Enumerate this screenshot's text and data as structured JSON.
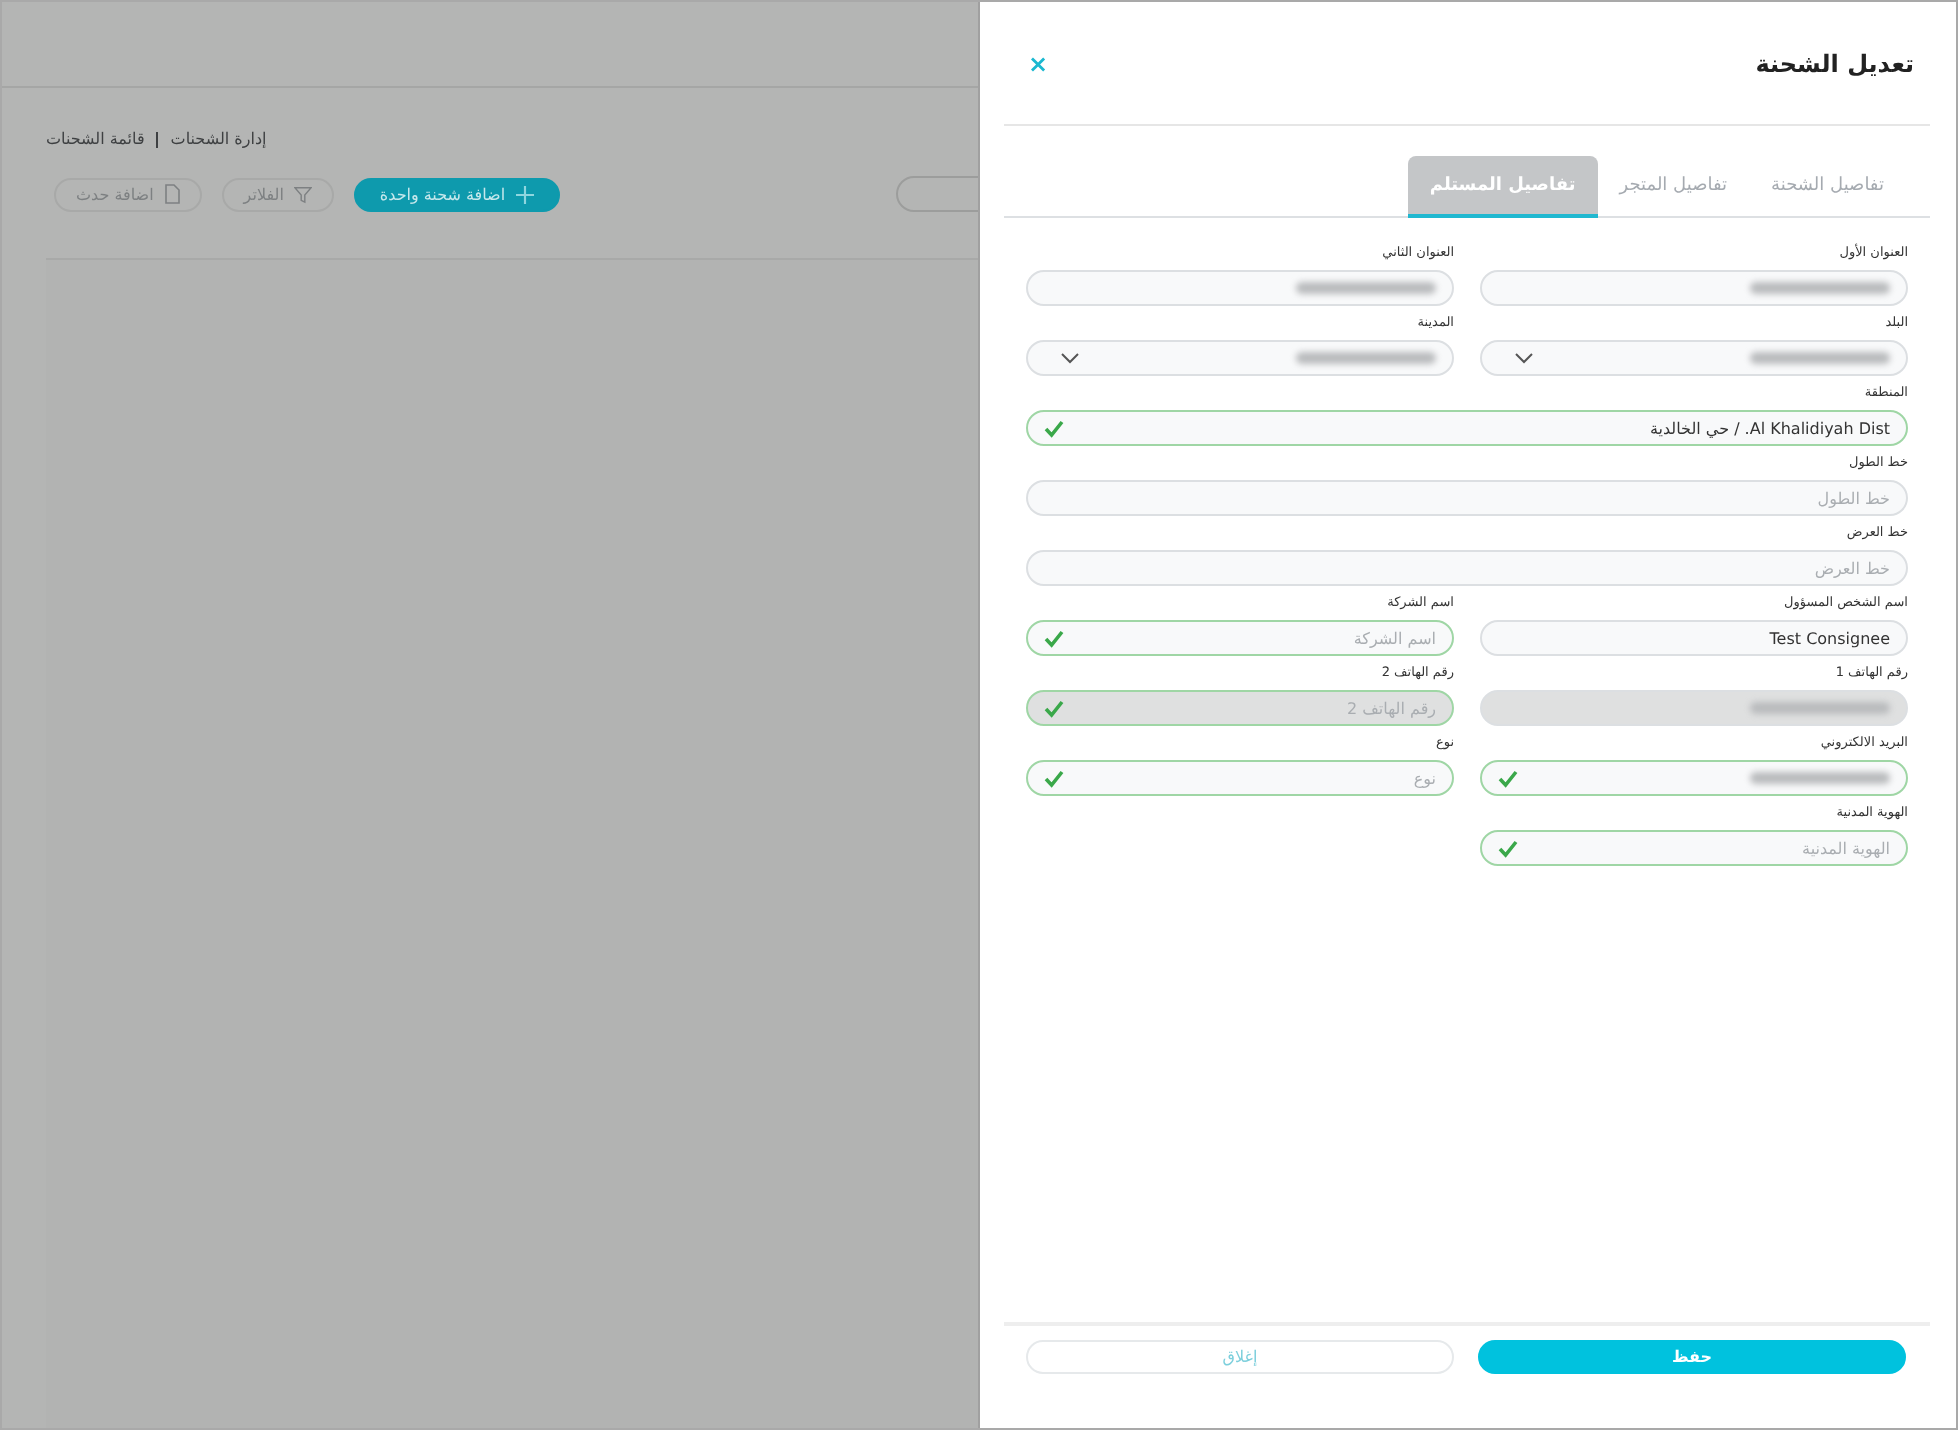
{
  "background": {
    "breadcrumb": [
      "إدارة الشحنات",
      "قائمة الشحنات"
    ],
    "toolbar": [
      {
        "label": "اضافة شحنة واحدة",
        "kind": "primary"
      },
      {
        "label": "الفلاتر",
        "kind": "filter"
      },
      {
        "label": "اضافة حدث",
        "kind": "event"
      }
    ]
  },
  "dialog": {
    "title": "تعديل الشحنة",
    "close": "×",
    "tabs": [
      {
        "label": "تفاصيل الشحنة",
        "selected": false
      },
      {
        "label": "تفاصيل المتجر",
        "selected": false
      },
      {
        "label": "تفاصيل المستلم",
        "selected": true
      }
    ],
    "fields": [
      {
        "label": "العنوان الأول",
        "kind": "text",
        "redacted": true,
        "valid": false,
        "disabled": false
      },
      {
        "label": "العنوان الثاني",
        "kind": "text",
        "redacted": true,
        "valid": false,
        "disabled": false
      },
      {
        "label": "البلد",
        "kind": "select",
        "redacted": true,
        "valid": false,
        "disabled": false
      },
      {
        "label": "المدينة",
        "kind": "select",
        "redacted": true,
        "valid": false,
        "disabled": false
      },
      {
        "label": "المنطقة",
        "kind": "wide-text",
        "value": "Al Khalidiyah Dist. / حي الخالدية",
        "valid": true,
        "disabled": false
      },
      {
        "label": "خط الطول",
        "kind": "wide-text",
        "placeholder": "خط الطول",
        "valid": false,
        "disabled": false
      },
      {
        "label": "خط العرض",
        "kind": "wide-text",
        "placeholder": "خط العرض",
        "valid": false,
        "disabled": false
      },
      {
        "label": "اسم الشخص المسؤول",
        "kind": "text",
        "value": "Test Consignee",
        "valid": false,
        "disabled": false
      },
      {
        "label": "اسم الشركة",
        "kind": "text",
        "placeholder": "اسم الشركة",
        "valid": true,
        "disabled": false
      },
      {
        "label": "رقم الهاتف 1",
        "kind": "text",
        "redacted": true,
        "valid": false,
        "disabled": true
      },
      {
        "label": "رقم الهاتف 2",
        "kind": "text",
        "placeholder": "رقم الهاتف 2",
        "valid": true,
        "disabled": true
      },
      {
        "label": "البريد الالكتروني",
        "kind": "text",
        "redacted": true,
        "valid": true,
        "disabled": false
      },
      {
        "label": "نوع",
        "kind": "text",
        "placeholder": "نوع",
        "valid": true,
        "disabled": false
      },
      {
        "label": "الهوية المدنية",
        "kind": "text",
        "placeholder": "الهوية المدنية",
        "valid": true,
        "disabled": false
      }
    ],
    "footer": [
      {
        "label": "حفظ",
        "kind": "primary"
      },
      {
        "label": "إغلاق",
        "kind": "secondary"
      }
    ]
  }
}
